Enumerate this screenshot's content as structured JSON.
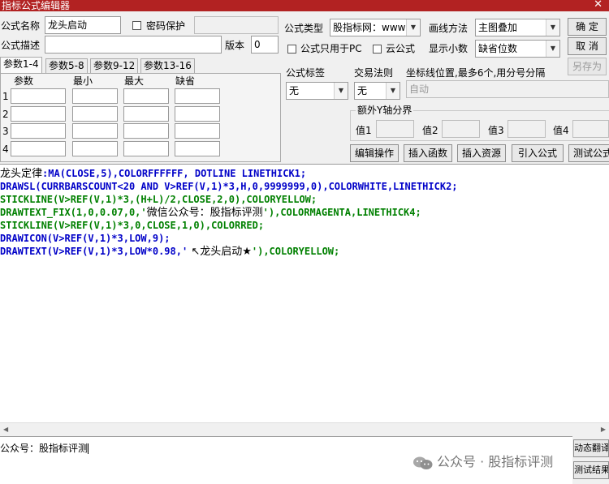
{
  "window": {
    "title": "指标公式编辑器",
    "close_glyph": "✕"
  },
  "form": {
    "name_label": "公式名称",
    "name_value": "龙头启动",
    "password_label": "密码保护",
    "desc_label": "公式描述",
    "version_label": "版本",
    "version_value": "0",
    "type_label": "公式类型",
    "type_value": "股指标网：www",
    "draw_label": "画线方法",
    "draw_value": "主图叠加",
    "pc_only_label": "公式只用于PC",
    "cloud_label": "云公式",
    "decimals_label": "显示小数",
    "decimals_value": "缺省位数",
    "tag_label": "公式标签",
    "tag_value": "无",
    "trade_label": "交易法则",
    "trade_value": "无",
    "coords_label": "坐标线位置,最多6个,用分号分隔",
    "coords_value": "自动",
    "extra_y_label": "额外Y轴分界",
    "val_labels": [
      "值1",
      "值2",
      "值3",
      "值4"
    ]
  },
  "buttons": {
    "ok": "确 定",
    "cancel": "取 消",
    "save_as": "另存为",
    "edit_ops": "编辑操作",
    "insert_func": "插入函数",
    "insert_res": "插入资源",
    "import": "引入公式",
    "test": "测试公式",
    "dyn_translate": "动态翻译",
    "test_result": "测试结果"
  },
  "params": {
    "tabs": [
      "参数1-4",
      "参数5-8",
      "参数9-12",
      "参数13-16"
    ],
    "columns": [
      "参数",
      "最小",
      "最大",
      "缺省"
    ],
    "rows": [
      "1",
      "2",
      "3",
      "4"
    ]
  },
  "code": {
    "l1a": "龙头定律",
    "l1b": ":MA(CLOSE,5),COLORFFFFFF, DOTLINE LINETHICK1;",
    "l2": "DRAWSL(CURRBARSCOUNT<20 AND V>REF(V,1)*3,H,0,9999999,0),COLORWHITE,LINETHICK2;",
    "l3": "STICKLINE(V>REF(V,1)*3,(H+L)/2,CLOSE,2,0),COLORYELLOW;",
    "l4a": "DRAWTEXT_FIX(1,0,0.07,0,'",
    "l4b": "微信公众号：股指标评测",
    "l4c": "'),COLORMAGENTA,LINETHICK4;",
    "l5": "STICKLINE(V>REF(V,1)*3,0,CLOSE,1,0),COLORRED;",
    "l6": "DRAWICON(V>REF(V,1)*3,LOW,9);",
    "l7a": "DRAWTEXT(V>REF(V,1)*3,LOW*0.98,'",
    "l7b": " ↖龙头启动★",
    "l7c": "'),COLORYELLOW;"
  },
  "bottom": {
    "text": "公众号：股指标评测",
    "watermark": "公众号 · 股指标评测"
  }
}
